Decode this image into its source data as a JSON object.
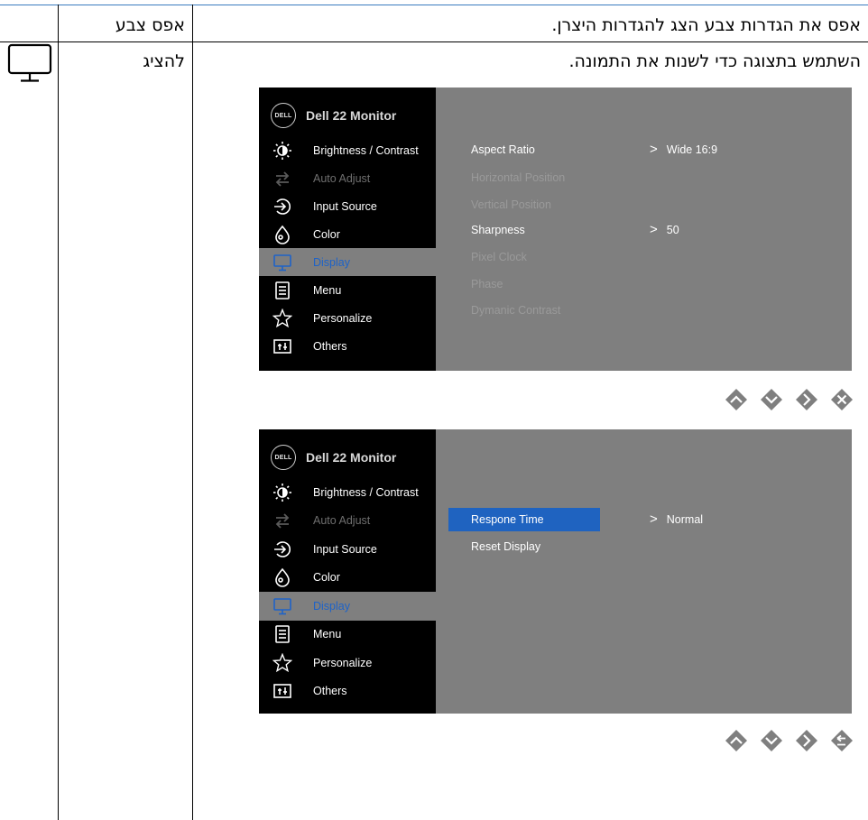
{
  "header": {
    "name": "אפס צבע",
    "description": "אפס את הגדרות צבע הצג להגדרות היצרן."
  },
  "row": {
    "name": "להציג",
    "description": "השתמש בתצוגה כדי לשנות את התמונה.",
    "icon": "monitor-icon"
  },
  "osd_brand": "Dell 22 Monitor",
  "osd_logo": "DELL",
  "osd_menu": [
    {
      "label": "Brightness / Contrast",
      "icon": "brightness-icon",
      "state": "normal"
    },
    {
      "label": "Auto Adjust",
      "icon": "auto-adjust-icon",
      "state": "dim"
    },
    {
      "label": "Input Source",
      "icon": "input-source-icon",
      "state": "normal"
    },
    {
      "label": "Color",
      "icon": "color-icon",
      "state": "normal"
    },
    {
      "label": "Display",
      "icon": "display-icon",
      "state": "active"
    },
    {
      "label": "Menu",
      "icon": "menu-icon",
      "state": "normal"
    },
    {
      "label": "Personalize",
      "icon": "star-icon",
      "state": "normal"
    },
    {
      "label": "Others",
      "icon": "others-icon",
      "state": "normal"
    }
  ],
  "osd1": {
    "submenu": [
      {
        "label": "Aspect Ratio",
        "state": "on"
      },
      {
        "label": "Horizontal Position",
        "state": "off"
      },
      {
        "label": "Vertical Position",
        "state": "off"
      },
      {
        "label": "Sharpness",
        "state": "on"
      },
      {
        "label": "Pixel Clock",
        "state": "off"
      },
      {
        "label": "Phase",
        "state": "off"
      },
      {
        "label": "Dymanic Contrast",
        "state": "off"
      }
    ],
    "values": [
      {
        "chevron": ">",
        "text": "Wide 16:9"
      },
      {
        "chevron": ">",
        "text": "50"
      }
    ],
    "buttons": [
      "up-button-icon",
      "down-button-icon",
      "right-button-icon",
      "close-button-icon"
    ]
  },
  "osd2": {
    "submenu": [
      {
        "label": "Respone Time",
        "state": "selected"
      },
      {
        "label": "Reset Display",
        "state": "on"
      }
    ],
    "values": [
      {
        "chevron": ">",
        "text": "Normal"
      }
    ],
    "buttons": [
      "up-button-icon",
      "down-button-icon",
      "right-button-icon",
      "back-button-icon"
    ]
  },
  "colors": {
    "osd_left": "#000000",
    "osd_right": "#7f7f7f",
    "highlight": "#1f63c0",
    "active_text": "#1e63c8"
  }
}
